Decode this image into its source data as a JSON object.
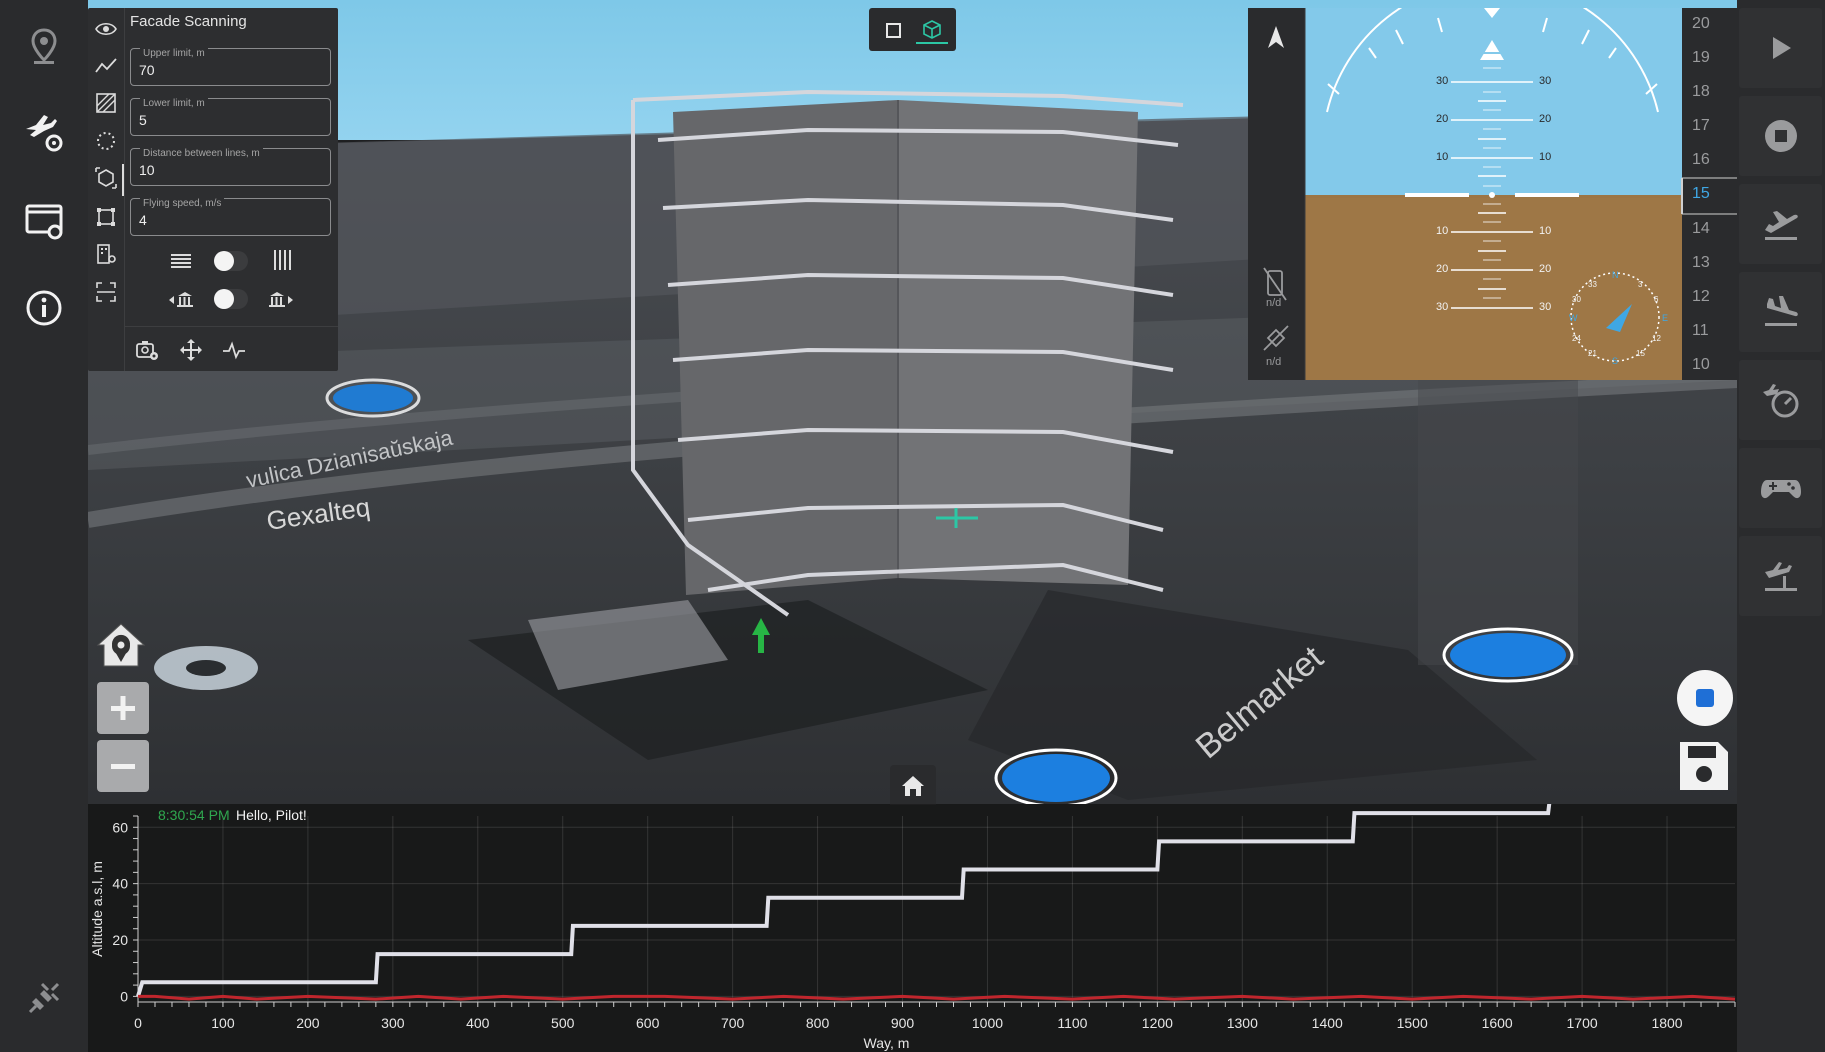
{
  "facade": {
    "title": "Facade Scanning",
    "upper_label": "Upper limit, m",
    "upper_value": "70",
    "lower_label": "Lower limit, m",
    "lower_value": "5",
    "distance_label": "Distance between lines, m",
    "distance_value": "10",
    "speed_label": "Flying speed, m/s",
    "speed_value": "4"
  },
  "attitude": {
    "pitch_labels": [
      "30",
      "20",
      "10",
      "10",
      "20",
      "30"
    ],
    "tape_values": [
      "20",
      "19",
      "18",
      "17",
      "16",
      "15",
      "14",
      "13",
      "12",
      "11",
      "10"
    ],
    "tape_current": "15",
    "battery_status": "n/d",
    "gps_status": "n/d",
    "compass_labels": [
      "N",
      "3",
      "6",
      "E",
      "12",
      "15",
      "S",
      "21",
      "24",
      "W",
      "30",
      "33"
    ]
  },
  "status": {
    "time": "8:30:54 PM",
    "message": "Hello, Pilot!"
  },
  "chart_data": {
    "type": "line",
    "title": "",
    "xlabel": "Way, m",
    "ylabel": "Altitude a.s.l, m",
    "xlim": [
      0,
      1880
    ],
    "ylim": [
      -2,
      64
    ],
    "x_ticks": [
      0,
      100,
      200,
      300,
      400,
      500,
      600,
      700,
      800,
      900,
      1000,
      1100,
      1200,
      1300,
      1400,
      1500,
      1600,
      1700,
      1800
    ],
    "y_ticks": [
      0,
      20,
      40,
      60
    ],
    "grid": true,
    "series": [
      {
        "color": "#e0e0e8",
        "x": [
          0,
          5,
          280,
          282,
          510,
          512,
          740,
          742,
          970,
          972,
          1200,
          1202,
          1430,
          1432,
          1660,
          1662,
          1880
        ],
        "y": [
          0,
          5,
          5,
          15,
          15,
          25,
          25,
          35,
          35,
          45,
          45,
          55,
          55,
          65,
          65,
          70,
          70
        ]
      },
      {
        "color": "#c0262d",
        "x": [
          0,
          20,
          60,
          100,
          140,
          200,
          280,
          330,
          380,
          430,
          500,
          560,
          620,
          700,
          760,
          830,
          900,
          960,
          1020,
          1100,
          1160,
          1220,
          1300,
          1360,
          1440,
          1500,
          1560,
          1640,
          1700,
          1760,
          1830,
          1880
        ],
        "y": [
          0,
          0,
          -1,
          0,
          -1,
          0,
          -1,
          0,
          -1,
          0,
          -1,
          0,
          0,
          -1,
          0,
          -1,
          0,
          -1,
          0,
          -1,
          0,
          -1,
          0,
          -1,
          0,
          -1,
          0,
          -1,
          0,
          -1,
          0,
          -1
        ]
      }
    ]
  }
}
